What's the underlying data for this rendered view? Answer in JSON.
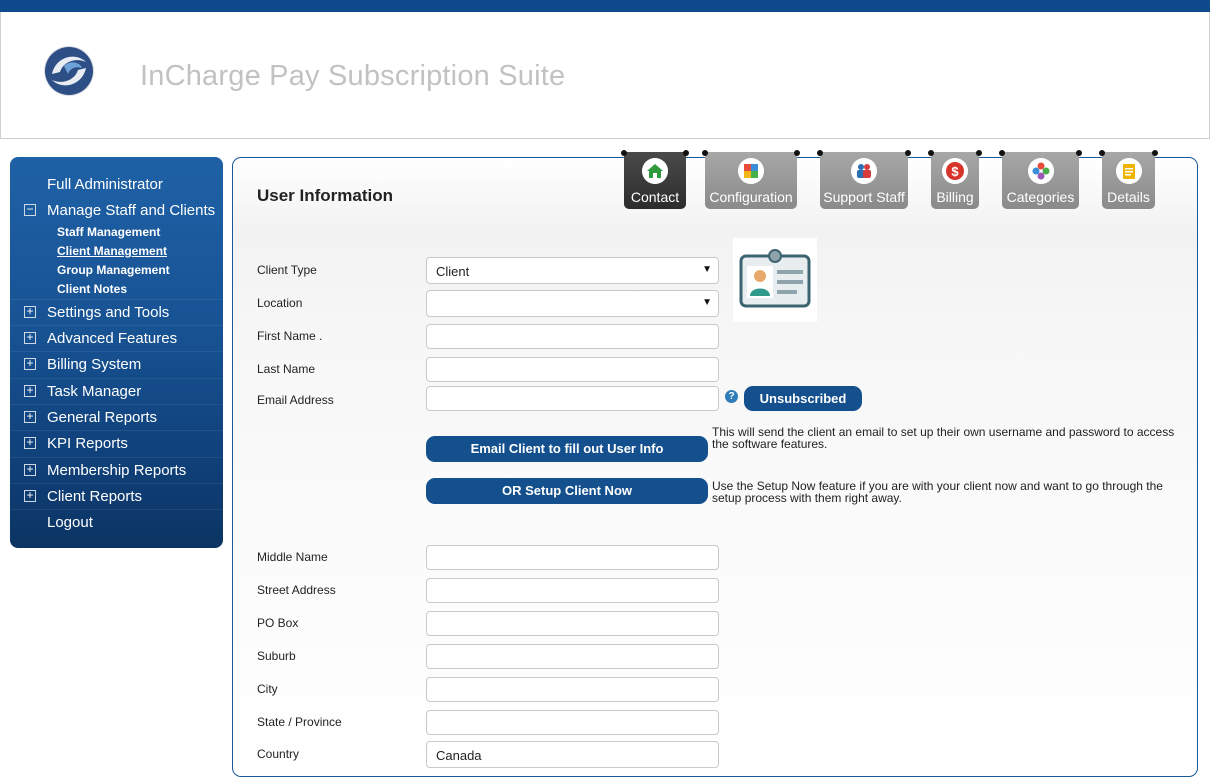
{
  "header": {
    "app_title": "InCharge Pay Subscription Suite",
    "logo_icon": "incharge-logo"
  },
  "sidebar": {
    "items": [
      {
        "label": "Full Administrator",
        "box": ""
      },
      {
        "label": "Manage Staff and Clients",
        "box": "−"
      },
      {
        "label": "Settings and Tools",
        "box": "+"
      },
      {
        "label": "Advanced Features",
        "box": "+"
      },
      {
        "label": "Billing System",
        "box": "+"
      },
      {
        "label": "Task Manager",
        "box": "+"
      },
      {
        "label": "General Reports",
        "box": "+"
      },
      {
        "label": "KPI Reports",
        "box": "+"
      },
      {
        "label": "Membership Reports",
        "box": "+"
      },
      {
        "label": "Client Reports",
        "box": "+"
      },
      {
        "label": "Logout",
        "box": ""
      }
    ],
    "subitems": [
      "Staff Management",
      "Client Management",
      "Group Management",
      "Client Notes"
    ],
    "active_subitem": "Client Management"
  },
  "main": {
    "title": "User Information",
    "tabs": [
      {
        "label": "Contact",
        "icon": "home-icon",
        "active": true
      },
      {
        "label": "Configuration",
        "icon": "puzzle-icon",
        "active": false
      },
      {
        "label": "Support Staff",
        "icon": "people-icon",
        "active": false
      },
      {
        "label": "Billing",
        "icon": "dollar-icon",
        "active": false
      },
      {
        "label": "Categories",
        "icon": "circles-icon",
        "active": false
      },
      {
        "label": "Details",
        "icon": "notepad-icon",
        "active": false
      }
    ],
    "form": {
      "client_type_label": "Client Type",
      "client_type_value": "Client",
      "location_label": "Location",
      "location_value": "",
      "first_name_label": "First Name .",
      "last_name_label": "Last Name",
      "email_label": "Email Address",
      "unsubscribed_label": "Unsubscribed",
      "email_client_button": "Email Client to fill out User Info",
      "email_client_note": "This will send the client an email to set up their own username and password to access the software features.",
      "setup_now_button": "OR Setup Client Now",
      "setup_now_note": "Use the Setup Now feature if you are with your client now and want to go through the setup process with them right away.",
      "middle_name_label": "Middle Name",
      "street_label": "Street Address",
      "po_box_label": "PO Box",
      "suburb_label": "Suburb",
      "city_label": "City",
      "state_label": "State / Province",
      "country_label": "Country",
      "country_value": "Canada"
    }
  },
  "colors": {
    "topbar": "#0f4a8c",
    "button_blue": "#14508e",
    "sidebar": "#175293"
  }
}
